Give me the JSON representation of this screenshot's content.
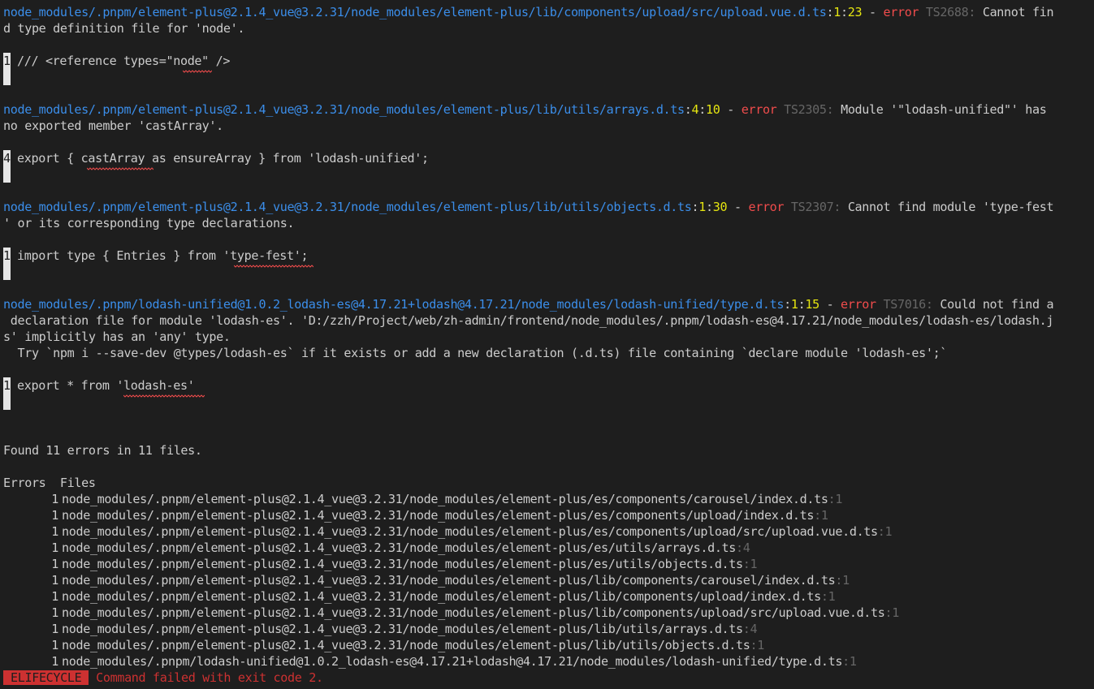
{
  "errors": [
    {
      "path": "node_modules/.pnpm/element-plus@2.1.4_vue@3.2.31/node_modules/element-plus/lib/components/upload/src/upload.vue.d.ts",
      "line": "1",
      "col": "23",
      "code": "TS2688:",
      "msg1": " Cannot fin",
      "msg_cont": [
        "d type definition file for 'node'."
      ],
      "src_line": "1",
      "src_text": "/// <reference types=\"node\" />"
    },
    {
      "path": "node_modules/.pnpm/element-plus@2.1.4_vue@3.2.31/node_modules/element-plus/lib/utils/arrays.d.ts",
      "line": "4",
      "col": "10",
      "code": "TS2305:",
      "msg1": " Module '\"lodash-unified\"' has",
      "msg_cont": [
        "no exported member 'castArray'."
      ],
      "src_line": "4",
      "src_text": "export { castArray as ensureArray } from 'lodash-unified';"
    },
    {
      "path": "node_modules/.pnpm/element-plus@2.1.4_vue@3.2.31/node_modules/element-plus/lib/utils/objects.d.ts",
      "line": "1",
      "col": "30",
      "code": "TS2307:",
      "msg1": " Cannot find module 'type-fest",
      "msg_cont": [
        "' or its corresponding type declarations."
      ],
      "src_line": "1",
      "src_text": "import type { Entries } from 'type-fest';"
    },
    {
      "path": "node_modules/.pnpm/lodash-unified@1.0.2_lodash-es@4.17.21+lodash@4.17.21/node_modules/lodash-unified/type.d.ts",
      "line": "1",
      "col": "15",
      "code": "TS7016:",
      "msg1": " Could not find a",
      "msg_cont": [
        " declaration file for module 'lodash-es'. 'D:/zzh/Project/web/zh-admin/frontend/node_modules/.pnpm/lodash-es@4.17.21/node_modules/lodash-es/lodash.j",
        "s' implicitly has an 'any' type.",
        "  Try `npm i --save-dev @types/lodash-es` if it exists or add a new declaration (.d.ts) file containing `declare module 'lodash-es';`"
      ],
      "src_line": "1",
      "src_text": "export * from 'lodash-es'"
    }
  ],
  "separator": " - ",
  "error_word": "error",
  "summary": "Found 11 errors in 11 files.",
  "table_header": "Errors  Files",
  "files": [
    {
      "count": "1",
      "path": "node_modules/.pnpm/element-plus@2.1.4_vue@3.2.31/node_modules/element-plus/es/components/carousel/index.d.ts",
      "line": ":1"
    },
    {
      "count": "1",
      "path": "node_modules/.pnpm/element-plus@2.1.4_vue@3.2.31/node_modules/element-plus/es/components/upload/index.d.ts",
      "line": ":1"
    },
    {
      "count": "1",
      "path": "node_modules/.pnpm/element-plus@2.1.4_vue@3.2.31/node_modules/element-plus/es/components/upload/src/upload.vue.d.ts",
      "line": ":1"
    },
    {
      "count": "1",
      "path": "node_modules/.pnpm/element-plus@2.1.4_vue@3.2.31/node_modules/element-plus/es/utils/arrays.d.ts",
      "line": ":4"
    },
    {
      "count": "1",
      "path": "node_modules/.pnpm/element-plus@2.1.4_vue@3.2.31/node_modules/element-plus/es/utils/objects.d.ts",
      "line": ":1"
    },
    {
      "count": "1",
      "path": "node_modules/.pnpm/element-plus@2.1.4_vue@3.2.31/node_modules/element-plus/lib/components/carousel/index.d.ts",
      "line": ":1"
    },
    {
      "count": "1",
      "path": "node_modules/.pnpm/element-plus@2.1.4_vue@3.2.31/node_modules/element-plus/lib/components/upload/index.d.ts",
      "line": ":1"
    },
    {
      "count": "1",
      "path": "node_modules/.pnpm/element-plus@2.1.4_vue@3.2.31/node_modules/element-plus/lib/components/upload/src/upload.vue.d.ts",
      "line": ":1"
    },
    {
      "count": "1",
      "path": "node_modules/.pnpm/element-plus@2.1.4_vue@3.2.31/node_modules/element-plus/lib/utils/arrays.d.ts",
      "line": ":4"
    },
    {
      "count": "1",
      "path": "node_modules/.pnpm/element-plus@2.1.4_vue@3.2.31/node_modules/element-plus/lib/utils/objects.d.ts",
      "line": ":1"
    },
    {
      "count": "1",
      "path": "node_modules/.pnpm/lodash-unified@1.0.2_lodash-es@4.17.21+lodash@4.17.21/node_modules/lodash-unified/type.d.ts",
      "line": ":1"
    }
  ],
  "lifecycle_badge": "ELIFECYCLE",
  "lifecycle_msg": "Command failed with exit code 2.",
  "colors": {
    "background": "#1e1e1e",
    "path": "#3b8eea",
    "location": "#e5e510",
    "error": "#f14c4c",
    "dim": "#666666",
    "badge": "#cd3131"
  }
}
